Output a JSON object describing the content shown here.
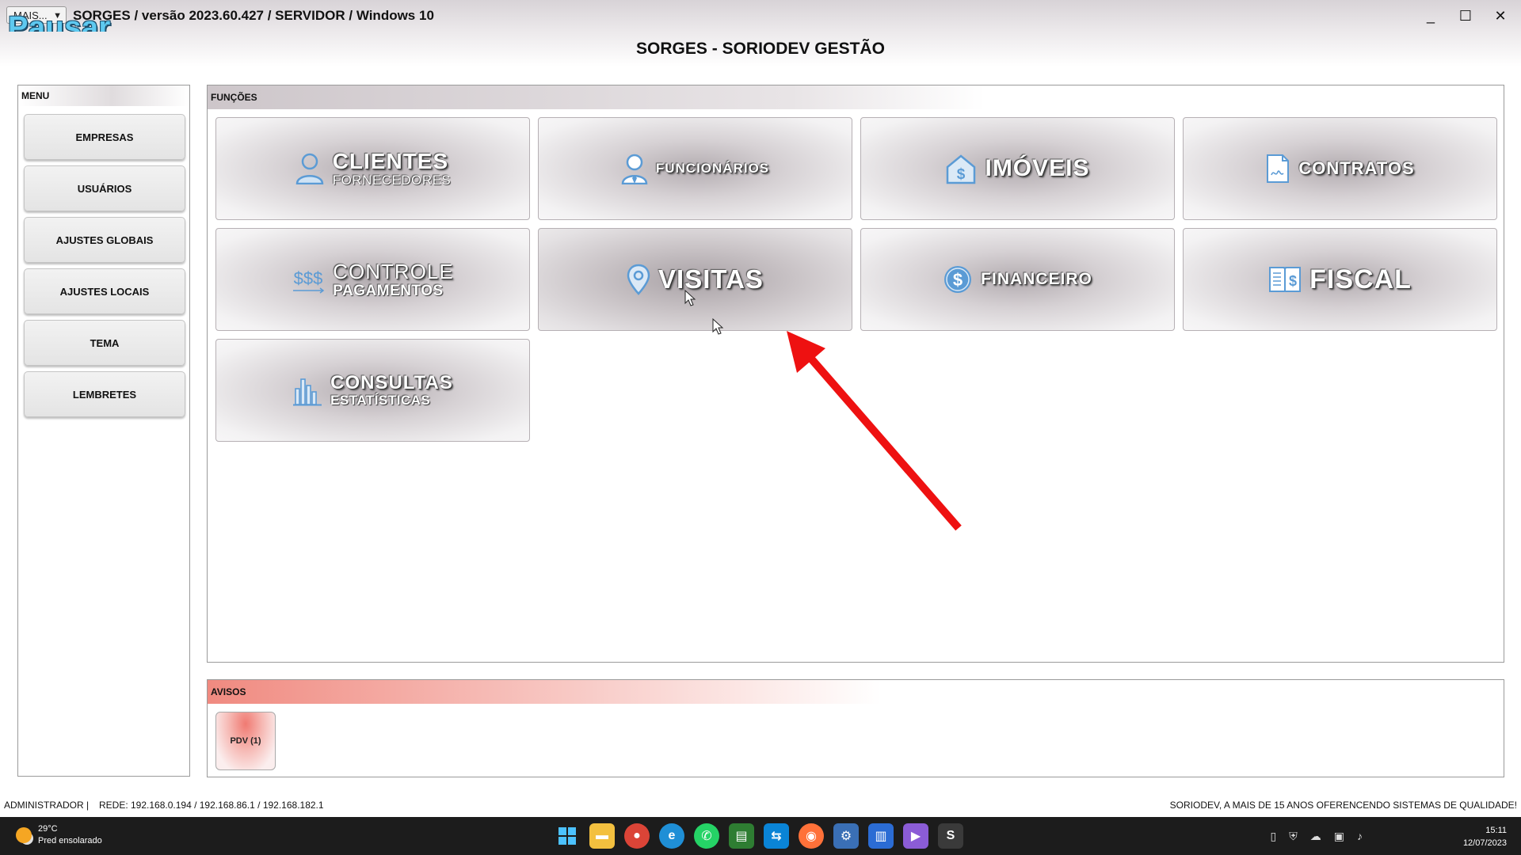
{
  "window": {
    "select_label": "MAIS...",
    "overlay_label": "Pausar",
    "title": "SORGES / versão 2023.60.427 / SERVIDOR / Windows 10",
    "app_title": "SORGES - SORIODEV GESTÃO"
  },
  "menu": {
    "header": "MENU",
    "items": [
      "EMPRESAS",
      "USUÁRIOS",
      "AJUSTES GLOBAIS",
      "AJUSTES LOCAIS",
      "TEMA",
      "LEMBRETES"
    ]
  },
  "functions": {
    "header": "FUNÇÕES",
    "tiles": [
      {
        "line1": "CLIENTES",
        "line2": "FORNECEDORES",
        "icon": "person-icon"
      },
      {
        "line1": "FUNCIONÁRIOS",
        "line2": "",
        "icon": "employee-icon"
      },
      {
        "line1": "IMÓVEIS",
        "line2": "",
        "icon": "house-dollar-icon"
      },
      {
        "line1": "CONTRATOS",
        "line2": "",
        "icon": "contract-icon"
      },
      {
        "line1": "CONTROLE",
        "line2": "PAGAMENTOS",
        "icon": "payments-icon"
      },
      {
        "line1": "VISITAS",
        "line2": "",
        "icon": "location-pin-icon"
      },
      {
        "line1": "FINANCEIRO",
        "line2": "",
        "icon": "dollar-circle-icon"
      },
      {
        "line1": "FISCAL",
        "line2": "",
        "icon": "fiscal-book-icon"
      },
      {
        "line1": "CONSULTAS",
        "line2": "ESTATÍSTICAS",
        "icon": "bar-chart-icon"
      }
    ]
  },
  "avisos": {
    "header": "AVISOS",
    "items": [
      "PDV (1)"
    ]
  },
  "status": {
    "user": "ADMINISTRADOR |",
    "network": "REDE: 192.168.0.194 / 192.168.86.1 / 192.168.182.1",
    "slogan": "SORIODEV, A MAIS DE 15 ANOS OFERENCENDO SISTEMAS DE QUALIDADE!"
  },
  "taskbar": {
    "temperature": "29°C",
    "weather": "Pred ensolarado",
    "time": "15:11",
    "date": "12/07/2023"
  },
  "colors": {
    "icon_blue": "#5b9bd5",
    "arrow_red": "#ee1111",
    "avisos_red": "#f08a80"
  }
}
